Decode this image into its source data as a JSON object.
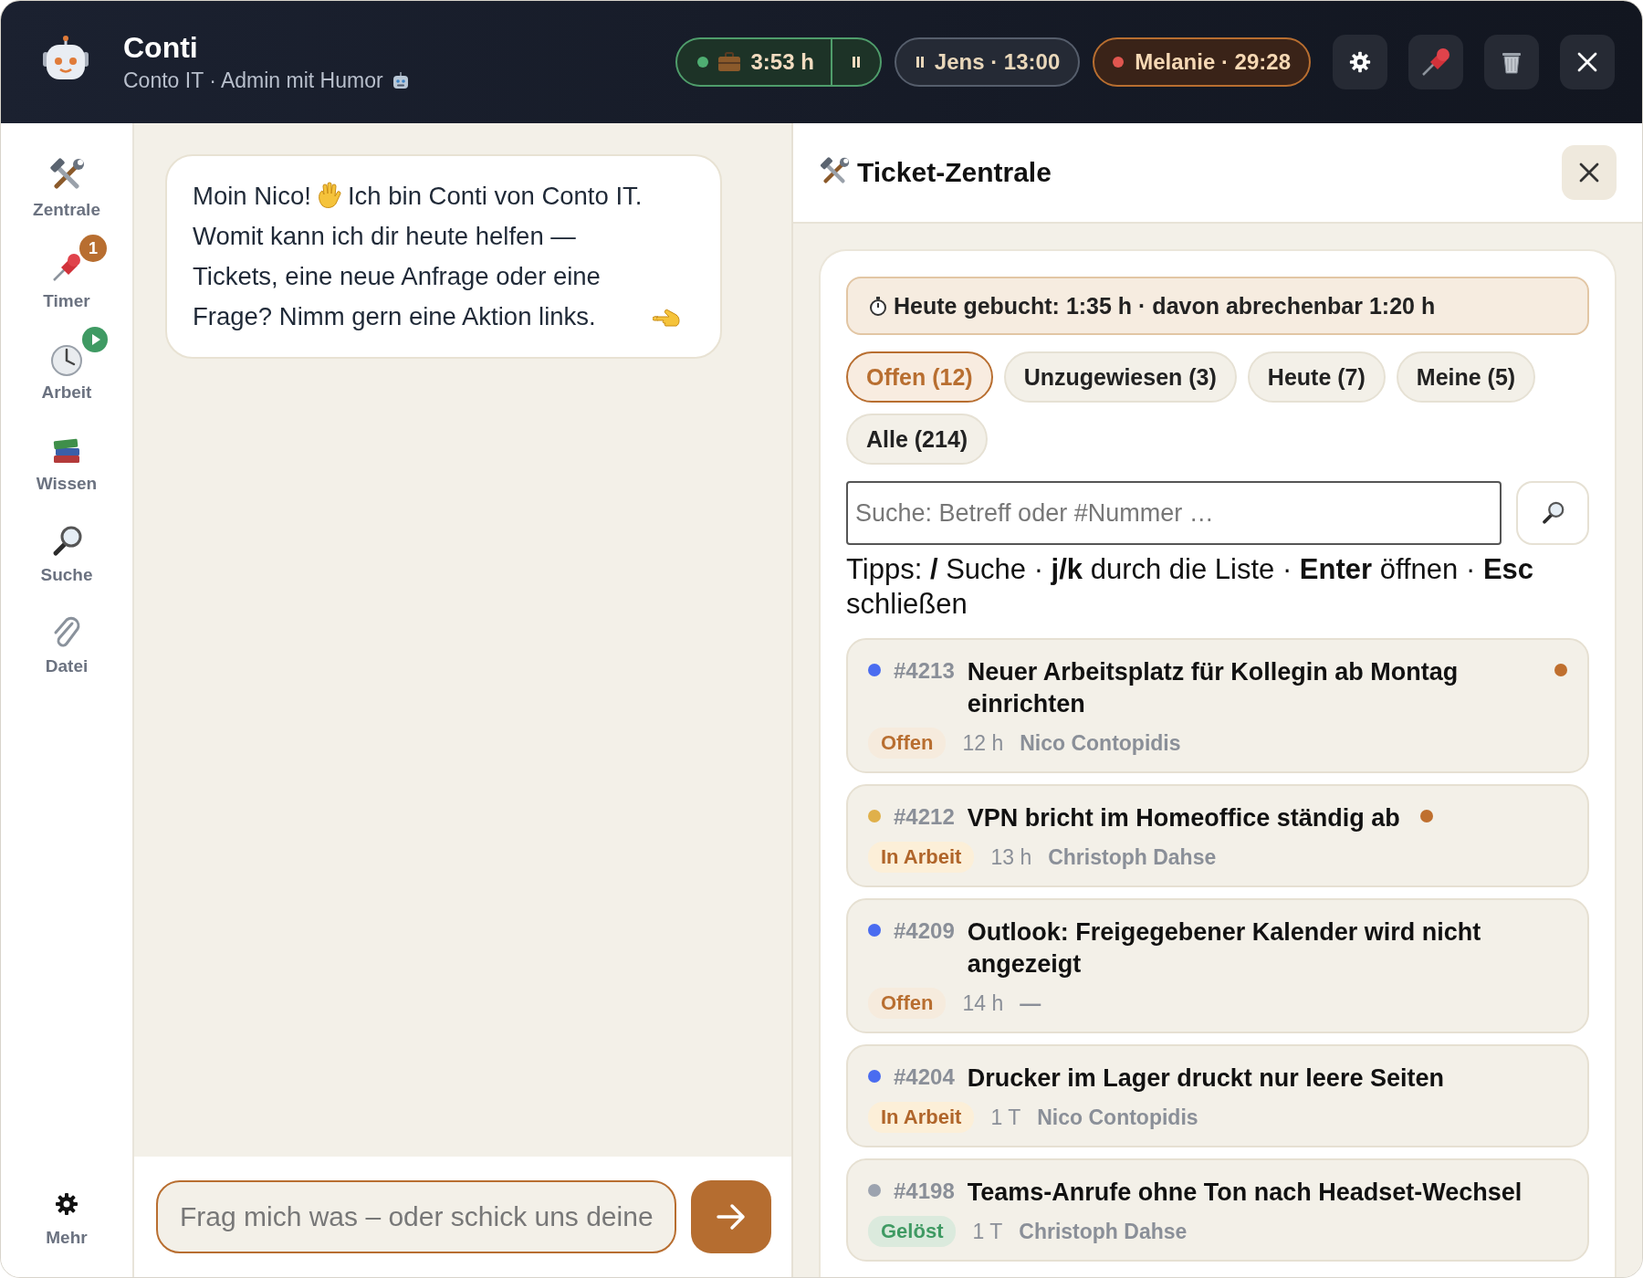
{
  "header": {
    "title": "Conti",
    "subtitle": "Conto IT · Admin mit Humor",
    "timers": [
      {
        "kind": "running",
        "text": "3:53 h"
      },
      {
        "kind": "paused",
        "text": "Jens · 13:00"
      },
      {
        "kind": "recording",
        "text": "Melanie · 29:28"
      }
    ]
  },
  "sidebar": {
    "items": [
      {
        "label": "Zentrale"
      },
      {
        "label": "Timer",
        "badge": "1"
      },
      {
        "label": "Arbeit",
        "running": true
      },
      {
        "label": "Wissen"
      },
      {
        "label": "Suche"
      },
      {
        "label": "Datei"
      }
    ],
    "footer": {
      "label": "Mehr"
    }
  },
  "chat": {
    "messages": [
      {
        "parts": [
          "Moin Nico!",
          "Ich bin Conti von Conto IT.",
          "Womit kann ich dir heute helfen — Tickets, eine neue Anfrage oder eine Frage? Nimm gern eine Aktion links."
        ]
      }
    ],
    "input": {
      "placeholder": "Frag mich was – oder schick uns deine"
    }
  },
  "panel": {
    "title": "Ticket-Zentrale",
    "booked": "Heute gebucht: 1:35 h · davon abrechenbar 1:20 h",
    "filters": [
      {
        "label": "Offen (12)",
        "selected": true
      },
      {
        "label": "Unzugewiesen (3)",
        "selected": false
      },
      {
        "label": "Heute (7)",
        "selected": false
      },
      {
        "label": "Meine (5)",
        "selected": false
      },
      {
        "label": "Alle (214)",
        "selected": false
      }
    ],
    "search": {
      "placeholder": "Suche: Betreff oder #Nummer …"
    },
    "tips": "Tipps: **/** Suche · **j/k** durch die Liste · **Enter** öffnen · **Esc** schließen",
    "tickets": [
      {
        "number": "#4213",
        "title": "Neuer Arbeitsplatz für Kollegin ab Montag einrichten",
        "color": "#4a6cf0",
        "flagged": true,
        "status": "Offen",
        "kind": "open",
        "age": "12 h",
        "assignee": "Nico Contopidis"
      },
      {
        "number": "#4212",
        "title": "VPN bricht im Homeoffice ständig ab",
        "color": "#e0b04a",
        "flagged": true,
        "status": "In Arbeit",
        "kind": "progress",
        "age": "13 h",
        "assignee": "Christoph Dahse"
      },
      {
        "number": "#4209",
        "title": "Outlook: Freigegebener Kalender wird nicht angezeigt",
        "color": "#4a6cf0",
        "flagged": false,
        "status": "Offen",
        "kind": "open",
        "age": "14 h",
        "assignee": "—"
      },
      {
        "number": "#4204",
        "title": "Drucker im Lager druckt nur leere Seiten",
        "color": "#4a6cf0",
        "flagged": false,
        "status": "In Arbeit",
        "kind": "progress",
        "age": "1 T",
        "assignee": "Nico Contopidis"
      },
      {
        "number": "#4198",
        "title": "Teams-Anrufe ohne Ton nach Headset-Wechsel",
        "color": "#9ca3af",
        "flagged": false,
        "status": "Gelöst",
        "kind": "solved",
        "age": "1 T",
        "assignee": "Christoph Dahse"
      }
    ]
  }
}
